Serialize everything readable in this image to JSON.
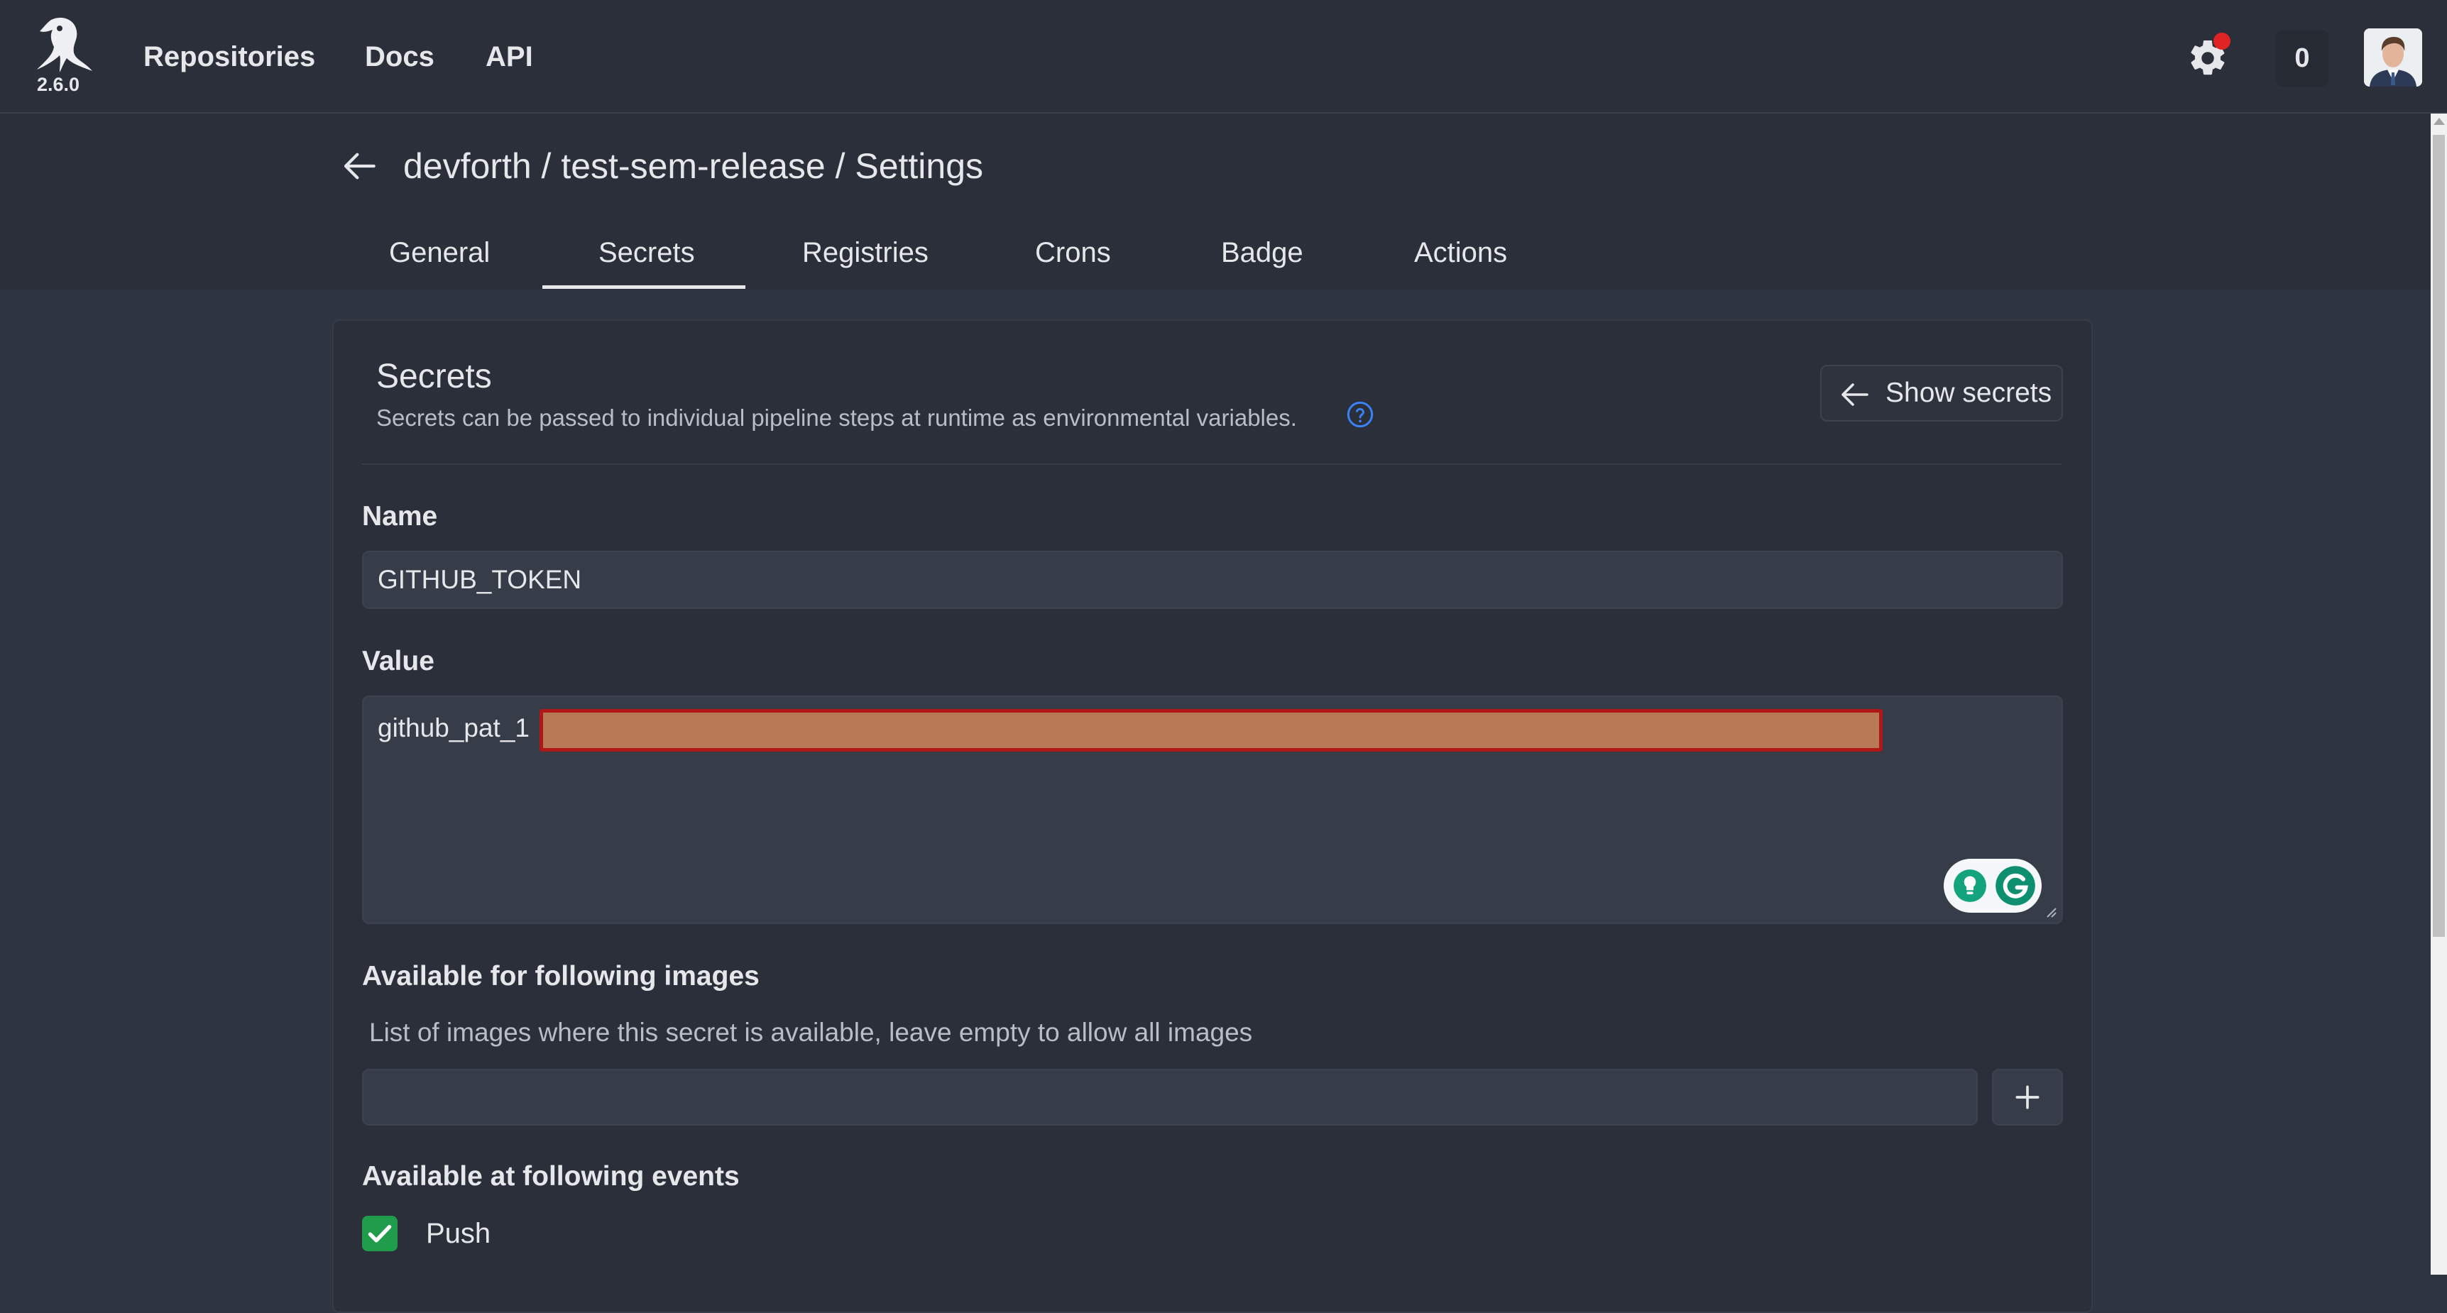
{
  "app": {
    "version": "2.6.0",
    "nav_links": [
      "Repositories",
      "Docs",
      "API"
    ],
    "notification_count": "0",
    "notification_dot_color": "#e02424"
  },
  "header": {
    "breadcrumb": "devforth / test-sem-release / Settings",
    "tabs": [
      "General",
      "Secrets",
      "Registries",
      "Crons",
      "Badge",
      "Actions"
    ],
    "active_tab": "Secrets"
  },
  "secrets": {
    "title": "Secrets",
    "description": "Secrets can be passed to individual pipeline steps at runtime as environmental variables.",
    "show_button": "Show secrets",
    "name_label": "Name",
    "name_value": "GITHUB_TOKEN",
    "value_label": "Value",
    "value_text": "github_pat_1",
    "images_label": "Available for following images",
    "images_hint": "List of images where this secret is available, leave empty to allow all images",
    "images_input_value": "",
    "events_label": "Available at following events",
    "events": [
      {
        "label": "Push",
        "checked": true
      }
    ]
  },
  "colors": {
    "background": "#2e3440",
    "surface": "#2a2f3a",
    "input": "#363c48",
    "checkbox": "#1f9d4a",
    "help_icon": "#3b82f6"
  },
  "icons": [
    "woodpecker-logo-icon",
    "gear-icon",
    "back-arrow-icon",
    "help-circle-icon",
    "arrow-left-icon",
    "plus-icon",
    "check-icon",
    "grammarly-icon",
    "lightbulb-icon"
  ]
}
